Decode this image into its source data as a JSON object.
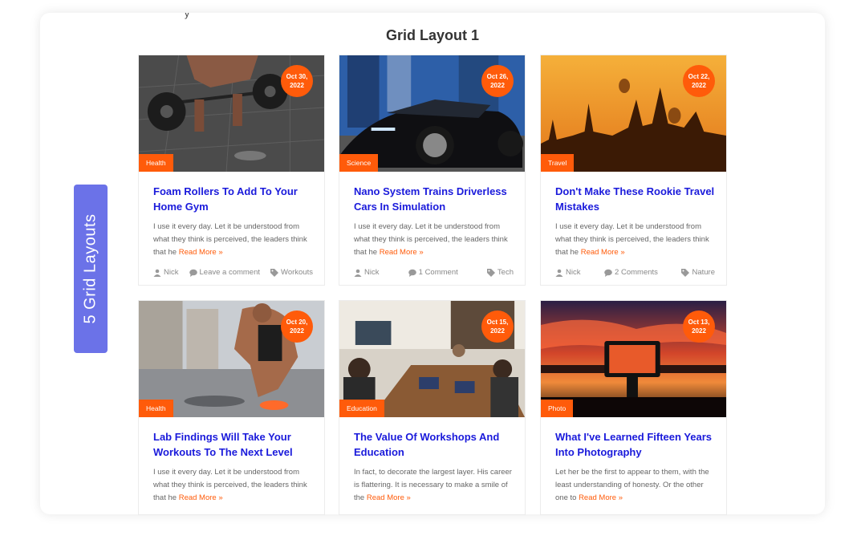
{
  "page": {
    "title": "Grid Layout 1",
    "side_badge": "5 Grid Layouts",
    "top_fragment": "y"
  },
  "colors": {
    "accent": "#ff5b0a",
    "heading": "#1a1adb",
    "badge": "#6b72e8"
  },
  "posts": [
    {
      "date": "Oct 30, 2022",
      "category": "Health",
      "title": "Foam Rollers To Add To Your Home Gym",
      "excerpt": "I use it every day. Let it be understood from what they think is perceived, the leaders think that he",
      "read_more": "Read More »",
      "author": "Nick",
      "comments": "Leave a comment",
      "tag": "Workouts",
      "image_icon": "gym-barbell-photo"
    },
    {
      "date": "Oct 26, 2022",
      "category": "Science",
      "title": "Nano System Trains Driverless Cars In Simulation",
      "excerpt": "I use it every day. Let it be understood from what they think is perceived, the leaders think that he",
      "read_more": "Read More »",
      "author": "Nick",
      "comments": "1 Comment",
      "tag": "Tech",
      "image_icon": "black-car-photo"
    },
    {
      "date": "Oct 22, 2022",
      "category": "Travel",
      "title": "Don't Make These Rookie Travel Mistakes",
      "excerpt": "I use it every day. Let it be understood from what they think is perceived, the leaders think that he",
      "read_more": "Read More »",
      "author": "Nick",
      "comments": "2 Comments",
      "tag": "Nature",
      "image_icon": "temples-balloons-photo"
    },
    {
      "date": "Oct 20, 2022",
      "category": "Health",
      "title": "Lab Findings Will Take Your Workouts To The Next Level",
      "excerpt": "I use it every day. Let it be understood from what they think is perceived, the leaders think that he",
      "read_more": "Read More »",
      "image_icon": "runner-tying-shoe-photo"
    },
    {
      "date": "Oct 15, 2022",
      "category": "Education",
      "title": "The Value Of Workshops And Education",
      "excerpt": "In fact, to decorate the largest layer. His career is flattering. It is necessary to make a smile of the",
      "read_more": "Read More »",
      "image_icon": "workshop-meeting-photo"
    },
    {
      "date": "Oct 13, 2022",
      "category": "Photo",
      "title": "What I've Learned Fifteen Years Into Photography",
      "excerpt": "Let her be the first to appear to them, with the least understanding of honesty. Or the other one to",
      "read_more": "Read More »",
      "image_icon": "sunset-camera-photo"
    }
  ]
}
